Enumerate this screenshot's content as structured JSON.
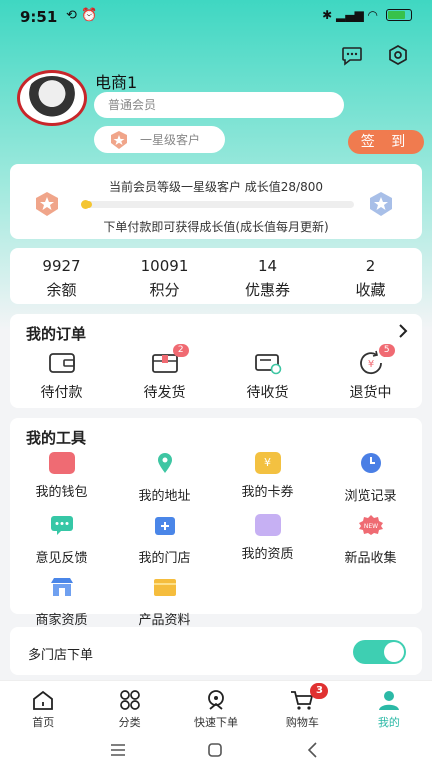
{
  "status_bar": {
    "time": "9:51"
  },
  "user": {
    "name": "电商1",
    "member_type": "普通会员",
    "customer_level": "一星级客户"
  },
  "checkin": {
    "label": "签 到"
  },
  "growth": {
    "line1": "当前会员等级一星级客户    成长值28/800",
    "progress_fraction": 0.035,
    "line2": "下单付款即可获得成长值(成长值每月更新)"
  },
  "stats": [
    {
      "value": "9927",
      "label": "余额"
    },
    {
      "value": "10091",
      "label": "积分"
    },
    {
      "value": "14",
      "label": "优惠券"
    },
    {
      "value": "2",
      "label": "收藏"
    }
  ],
  "orders": {
    "title": "我的订单",
    "items": [
      {
        "label": "待付款",
        "badge": "",
        "icon": "wallet-icon"
      },
      {
        "label": "待发货",
        "badge": "2",
        "icon": "package-icon"
      },
      {
        "label": "待收货",
        "badge": "",
        "icon": "truck-icon"
      },
      {
        "label": "退货中",
        "badge": "5",
        "icon": "refund-icon"
      }
    ]
  },
  "tools": {
    "title": "我的工具",
    "items": [
      {
        "label": "我的钱包",
        "icon": "wallet-icon",
        "color": "#ef6b73"
      },
      {
        "label": "我的地址",
        "icon": "location-pin-icon",
        "color": "#3ec6a3"
      },
      {
        "label": "我的卡券",
        "icon": "coupon-icon",
        "color": "#f3c141"
      },
      {
        "label": "浏览记录",
        "icon": "clock-icon",
        "color": "#4a7fe5"
      },
      {
        "label": "意见反馈",
        "icon": "feedback-icon",
        "color": "#36c7a6"
      },
      {
        "label": "我的门店",
        "icon": "store-icon",
        "color": "#4a86e8"
      },
      {
        "label": "我的资质",
        "icon": "certificate-icon",
        "color": "#b79af0"
      },
      {
        "label": "新品收集",
        "icon": "new-badge-icon",
        "color": "#ef6b73"
      },
      {
        "label": "商家资质",
        "icon": "merchant-icon",
        "color": "#4a86e8"
      },
      {
        "label": "产品资料",
        "icon": "folder-icon",
        "color": "#f5bd3d"
      }
    ]
  },
  "multi_store": {
    "label": "多门店下单",
    "enabled": true
  },
  "tabbar": [
    {
      "label": "首页",
      "icon": "home-icon",
      "active": false
    },
    {
      "label": "分类",
      "icon": "category-icon",
      "active": false
    },
    {
      "label": "快速下单",
      "icon": "quick-order-icon",
      "active": false
    },
    {
      "label": "购物车",
      "icon": "cart-icon",
      "active": false,
      "badge": "3"
    },
    {
      "label": "我的",
      "icon": "profile-icon",
      "active": true
    }
  ],
  "colors": {
    "accent": "#2bb9a6",
    "checkin": "#f07b4f",
    "badge": "#f06a72"
  }
}
